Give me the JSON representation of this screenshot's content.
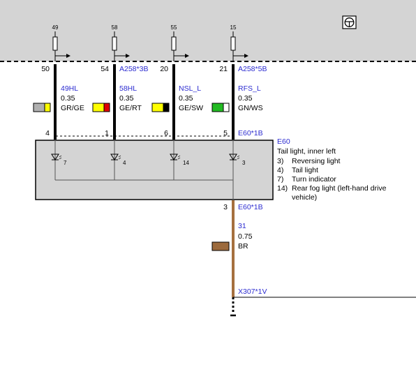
{
  "top_pins": [
    {
      "label": "49"
    },
    {
      "label": "58"
    },
    {
      "label": "55"
    },
    {
      "label": "15"
    }
  ],
  "wires": [
    {
      "pin_top": "50",
      "pin_side": "54",
      "connector_top": "",
      "circuit": "49HL",
      "gauge": "0.35",
      "color_code": "GR/GE",
      "colors": [
        "#b0b0b0",
        "#ffff00"
      ],
      "pin_bottom": "4",
      "connector_bottom": ""
    },
    {
      "pin_top": "54",
      "pin_side": "",
      "connector_top": "A258*3B",
      "circuit": "58HL",
      "gauge": "0.35",
      "color_code": "GE/RT",
      "colors": [
        "#ffff00",
        "#e00000"
      ],
      "pin_bottom": "1",
      "connector_bottom": ""
    },
    {
      "pin_top": "20",
      "pin_side": "",
      "connector_top": "",
      "circuit": "NSL_L",
      "gauge": "0.35",
      "color_code": "GE/SW",
      "colors": [
        "#ffff00",
        "#000000"
      ],
      "pin_bottom": "6",
      "connector_bottom": ""
    },
    {
      "pin_top": "21",
      "pin_side": "",
      "connector_top": "A258*5B",
      "circuit": "RFS_L",
      "gauge": "0.35",
      "color_code": "GN/WS",
      "colors": [
        "#22bb22",
        "#ffffff"
      ],
      "pin_bottom": "5",
      "connector_bottom": "E60*1B"
    }
  ],
  "lamps": [
    {
      "number": "7"
    },
    {
      "number": "4"
    },
    {
      "number": "14"
    },
    {
      "number": "3"
    }
  ],
  "component": {
    "id": "E60",
    "name": "Tail light, inner left",
    "functions": [
      {
        "num": "3)",
        "text": "Reversing light"
      },
      {
        "num": "4)",
        "text": "Tail light"
      },
      {
        "num": "7)",
        "text": "Turn indicator"
      },
      {
        "num": "14)",
        "text": "Rear fog light (left-hand drive"
      }
    ],
    "functions_cont": "vehicle)"
  },
  "ground_wire": {
    "pin": "3",
    "connector": "E60*1B",
    "circuit": "31",
    "gauge": "0.75",
    "color_code": "BR",
    "colors": [
      "#9c6a3c"
    ],
    "end_connector": "X307*1V"
  },
  "colors": {
    "blue_text": "#2b2bd0",
    "grey_area": "#d4d4d4",
    "ground_wire": "#a6703f"
  },
  "icons": {
    "corner": "steering-wheel-icon"
  }
}
